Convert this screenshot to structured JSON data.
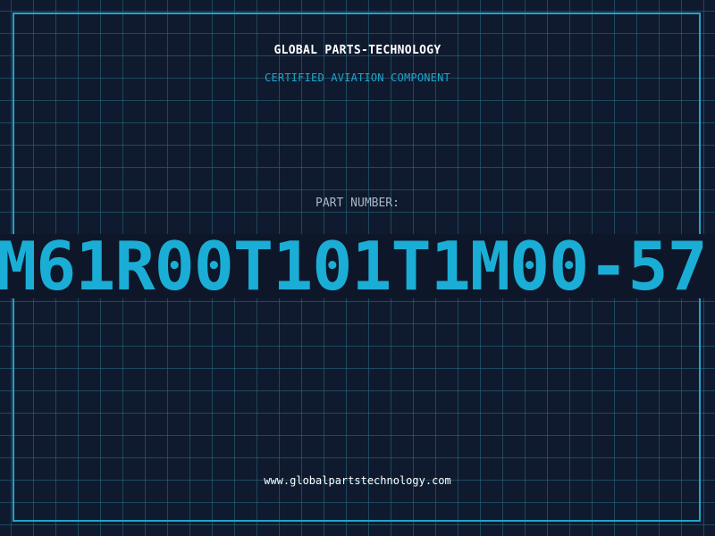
{
  "header": {
    "company": "GLOBAL PARTS-TECHNOLOGY",
    "subtitle": "CERTIFIED AVIATION COMPONENT"
  },
  "part": {
    "label": "PART NUMBER:",
    "number": "M61R00T101T1M00-57"
  },
  "footer": {
    "url": "www.globalpartstechnology.com"
  },
  "colors": {
    "background": "#0f1a2e",
    "accent": "#1fa5cc",
    "part_number": "#1aaed6",
    "label": "#aab7c8",
    "heading": "#ffffff"
  }
}
